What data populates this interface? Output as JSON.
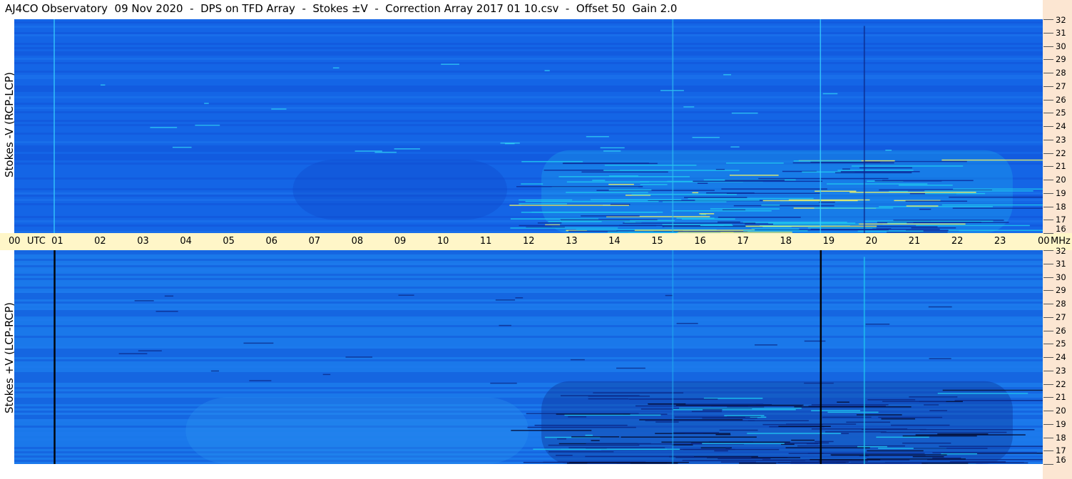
{
  "title": "AJ4CO Observatory  09 Nov 2020  -  DPS on TFD Array  -  Stokes ±V  -  Correction Array 2017 01 10.csv  -  Offset 50  Gain 2.0",
  "chart_data": [
    {
      "type": "heatmap",
      "panel": "top",
      "ylabel": "Stokes -V (RCP-LCP)",
      "x_ticks": [
        "00",
        "01",
        "02",
        "03",
        "04",
        "05",
        "06",
        "07",
        "08",
        "09",
        "10",
        "11",
        "12",
        "13",
        "14",
        "15",
        "16",
        "17",
        "18",
        "19",
        "20",
        "21",
        "22",
        "23",
        "00"
      ],
      "x_unit": "UTC",
      "y_ticks": [
        "32",
        "31",
        "30",
        "29",
        "28",
        "27",
        "26",
        "25",
        "24",
        "23",
        "22",
        "21",
        "20",
        "19",
        "18",
        "17",
        "16"
      ],
      "y_unit": "MHz",
      "ylim": [
        16,
        32
      ],
      "xlim_hours": [
        0,
        24
      ],
      "colors": {
        "background": "#1565e6",
        "quiet": "#0f4fd6",
        "burst": "#1fc4f0",
        "hot": "#e8f06a"
      }
    },
    {
      "type": "heatmap",
      "panel": "bottom",
      "ylabel": "Stokes +V (LCP-RCP)",
      "x_ticks": [
        "00",
        "01",
        "02",
        "03",
        "04",
        "05",
        "06",
        "07",
        "08",
        "09",
        "10",
        "11",
        "12",
        "13",
        "14",
        "15",
        "16",
        "17",
        "18",
        "19",
        "20",
        "21",
        "22",
        "23",
        "00"
      ],
      "x_unit": "UTC",
      "y_ticks": [
        "32",
        "31",
        "30",
        "29",
        "28",
        "27",
        "26",
        "25",
        "24",
        "23",
        "22",
        "21",
        "20",
        "19",
        "18",
        "17",
        "16"
      ],
      "y_unit": "MHz",
      "ylim": [
        16,
        32
      ],
      "xlim_hours": [
        0,
        24
      ],
      "colors": {
        "background": "#1a78ea",
        "quiet": "#0f4fd6",
        "dark": "#0b2a8a",
        "burst": "#1fc4f0"
      }
    }
  ],
  "axis": {
    "time_labels": [
      "00",
      "01",
      "02",
      "03",
      "04",
      "05",
      "06",
      "07",
      "08",
      "09",
      "10",
      "11",
      "12",
      "13",
      "14",
      "15",
      "16",
      "17",
      "18",
      "19",
      "20",
      "21",
      "22",
      "23",
      "00"
    ],
    "utc_label": "UTC",
    "mhz_label": "MHz"
  }
}
